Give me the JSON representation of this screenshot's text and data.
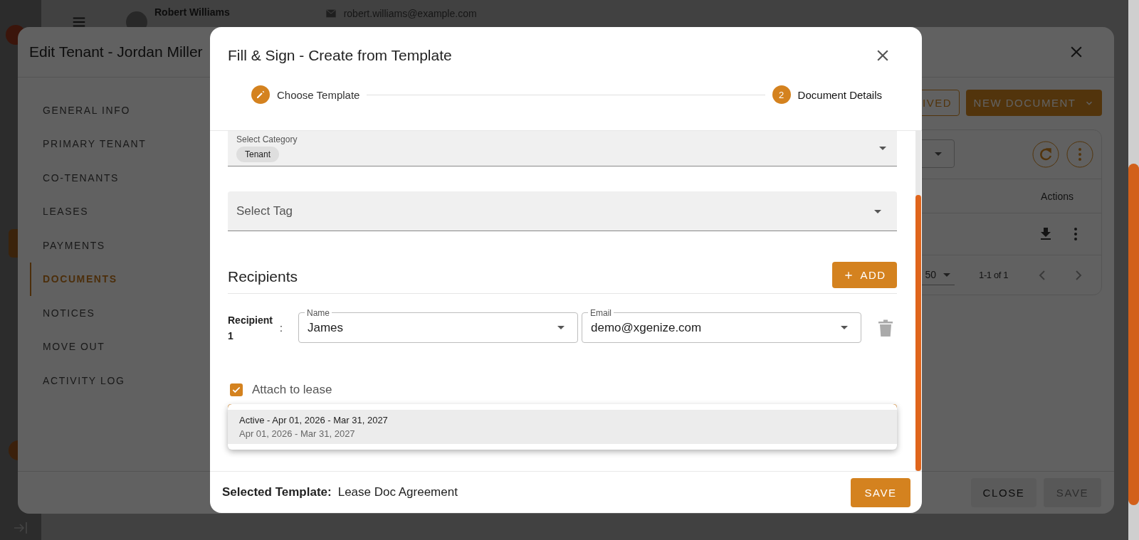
{
  "app_page": {
    "header": {
      "name": "Robert Williams",
      "email": "robert.williams@example.com"
    }
  },
  "edit_tenant_dialog": {
    "title": "Edit Tenant - Jordan Miller",
    "nav": [
      {
        "label": "GENERAL INFO",
        "selected": false
      },
      {
        "label": "PRIMARY TENANT",
        "selected": false
      },
      {
        "label": "CO-TENANTS",
        "selected": false
      },
      {
        "label": "LEASES",
        "selected": false
      },
      {
        "label": "PAYMENTS",
        "selected": false
      },
      {
        "label": "DOCUMENTS",
        "selected": true
      },
      {
        "label": "NOTICES",
        "selected": false
      },
      {
        "label": "MOVE OUT",
        "selected": false
      },
      {
        "label": "ACTIVITY LOG",
        "selected": false
      }
    ],
    "toolbar_buttons": [
      {
        "label": "IVED",
        "kind": "outlined"
      },
      {
        "label": "NEW DOCUMENT",
        "kind": "menu"
      }
    ],
    "table": {
      "columns": [
        "Actions"
      ]
    },
    "pagination": {
      "rows_per_page": "50",
      "range": "1-1 of 1"
    },
    "footer_buttons": [
      {
        "label": "CLOSE",
        "disabled": false
      },
      {
        "label": "SAVE",
        "disabled": true
      }
    ]
  },
  "fill_sign_dialog": {
    "title": "Fill & Sign - Create from Template",
    "steps": [
      {
        "label": "Choose Template",
        "completed": true
      },
      {
        "number": "2",
        "label": "Document Details",
        "completed": false
      }
    ],
    "category_field": {
      "label": "Select Category",
      "chips": [
        "Tenant"
      ]
    },
    "tag_field": {
      "placeholder": "Select Tag"
    },
    "recipients": {
      "title": "Recipients",
      "add_button": "ADD",
      "items": [
        {
          "label": "Recipient 1",
          "separator": ":",
          "name_label": "Name",
          "name": "James",
          "email_label": "Email",
          "email": "demo@xgenize.com"
        }
      ]
    },
    "attach_to_lease": {
      "label": "Attach to lease",
      "checked": true
    },
    "lease_menu": {
      "options": [
        {
          "title": "Active - Apr 01, 2026 - Mar 31, 2027",
          "subtitle": "Apr 01, 2026 - Mar 31, 2027",
          "selected": true
        }
      ]
    },
    "footer": {
      "label": "Selected Template:",
      "value": "Lease Doc Agreement",
      "save_button": "SAVE"
    }
  }
}
